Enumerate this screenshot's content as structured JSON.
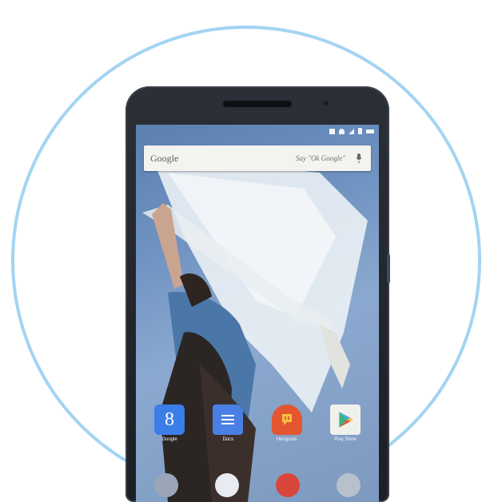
{
  "search": {
    "logo": "Google",
    "hint": "Say \"Ok Google\""
  },
  "apps": [
    {
      "name": "google-app",
      "label": "Google",
      "icon": "google-g-icon",
      "color": "#3b7ee8"
    },
    {
      "name": "docs-app",
      "label": "Docs",
      "icon": "docs-icon",
      "color": "#4a7fe6"
    },
    {
      "name": "hangouts-app",
      "label": "Hangouts",
      "icon": "hangouts-icon",
      "color": "#e4562f"
    },
    {
      "name": "play-store-app",
      "label": "Play Store",
      "icon": "play-store-icon",
      "color": "#f0f0ec"
    }
  ],
  "colors": {
    "ring": "#a3d4f2",
    "phone_body": "#1c1f24"
  }
}
